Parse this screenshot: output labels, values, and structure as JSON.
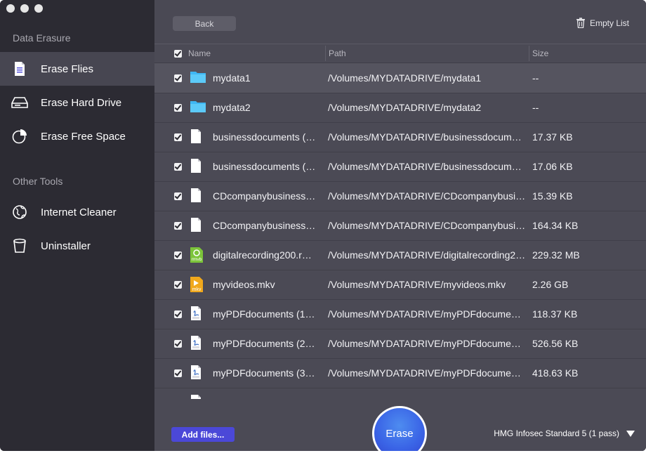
{
  "sidebar": {
    "section1": "Data Erasure",
    "section2": "Other Tools",
    "items": [
      {
        "label": "Erase Flies",
        "icon": "document-icon",
        "active": true
      },
      {
        "label": "Erase Hard Drive",
        "icon": "hard-drive-icon",
        "active": false
      },
      {
        "label": "Erase Free Space",
        "icon": "pie-chart-icon",
        "active": false
      },
      {
        "label": "Internet Cleaner",
        "icon": "globe-icon",
        "active": false
      },
      {
        "label": "Uninstaller",
        "icon": "trash-bin-icon",
        "active": false
      }
    ]
  },
  "toolbar": {
    "back_label": "Back",
    "empty_list_label": "Empty List"
  },
  "table": {
    "columns": {
      "name": "Name",
      "path": "Path",
      "size": "Size"
    },
    "rows": [
      {
        "name": "mydata1",
        "path": "/Volumes/MYDATADRIVE/mydata1",
        "size": "--",
        "type": "folder"
      },
      {
        "name": "mydata2",
        "path": "/Volumes/MYDATADRIVE/mydata2",
        "size": "--",
        "type": "folder"
      },
      {
        "name": "businessdocuments (…",
        "path": "/Volumes/MYDATADRIVE/businessdocume…",
        "size": "17.37 KB",
        "type": "file"
      },
      {
        "name": "businessdocuments (…",
        "path": "/Volumes/MYDATADRIVE/businessdocume…",
        "size": "17.06 KB",
        "type": "file"
      },
      {
        "name": "CDcompanybusiness…",
        "path": "/Volumes/MYDATADRIVE/CDcompanybusin…",
        "size": "15.39 KB",
        "type": "file"
      },
      {
        "name": "CDcompanybusiness…",
        "path": "/Volumes/MYDATADRIVE/CDcompanybusin…",
        "size": "164.34 KB",
        "type": "file"
      },
      {
        "name": "digitalrecording200.r…",
        "path": "/Volumes/MYDATADRIVE/digitalrecording2…",
        "size": "229.32 MB",
        "type": "rmvb",
        "badge": "rmvb"
      },
      {
        "name": "myvideos.mkv",
        "path": "/Volumes/MYDATADRIVE/myvideos.mkv",
        "size": "2.26 GB",
        "type": "mkv",
        "badge": "mkv"
      },
      {
        "name": "myPDFdocuments (1…",
        "path": "/Volumes/MYDATADRIVE/myPDFdocument…",
        "size": "118.37 KB",
        "type": "pdf"
      },
      {
        "name": "myPDFdocuments (2…",
        "path": "/Volumes/MYDATADRIVE/myPDFdocument…",
        "size": "526.56 KB",
        "type": "pdf"
      },
      {
        "name": "myPDFdocuments (3…",
        "path": "/Volumes/MYDATADRIVE/myPDFdocument…",
        "size": "418.63 KB",
        "type": "pdf"
      }
    ]
  },
  "footer": {
    "add_files_label": "Add files...",
    "erase_label": "Erase",
    "method_label": "HMG Infosec Standard 5 (1 pass)"
  },
  "colors": {
    "accent": "#4b48d8",
    "erase": "#3a64e6",
    "sidebar": "#2c2b33",
    "main": "#4b4a55"
  }
}
